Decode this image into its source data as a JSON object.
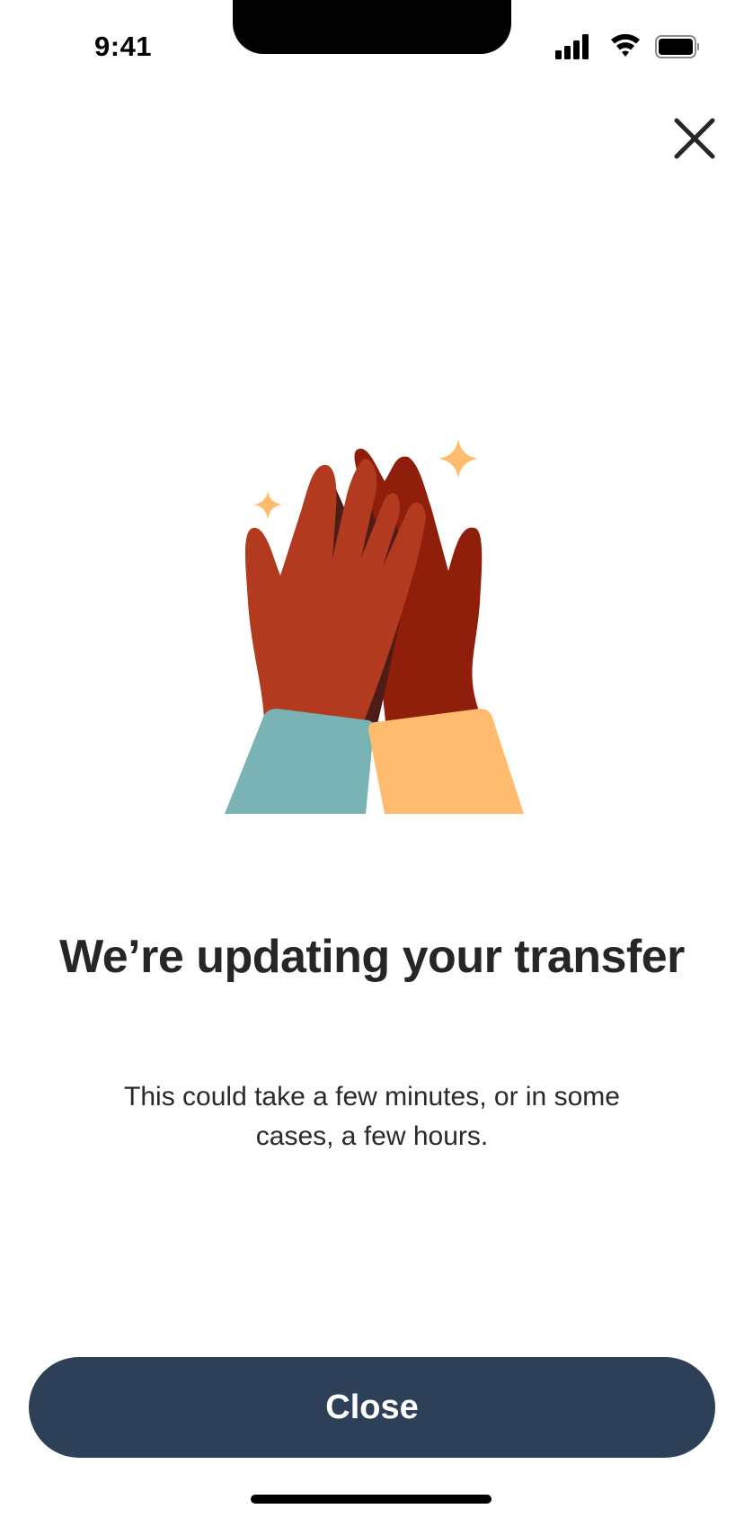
{
  "status_bar": {
    "time": "9:41",
    "icons": [
      "cellular-signal-icon",
      "wifi-icon",
      "battery-icon"
    ]
  },
  "header": {
    "close_icon": "close-icon"
  },
  "illustration": {
    "name": "high-five-hands",
    "colors": {
      "left_hand": "#b23a1f",
      "right_hand": "#8f1f0a",
      "shadow": "#4e1c17",
      "left_sleeve": "#79b3b6",
      "right_sleeve": "#ffbc6e",
      "sparkle": "#ffbc6e"
    }
  },
  "content": {
    "title": "We’re updating your transfer",
    "subtitle": "This could take a few minutes, or in some cases, a few hours."
  },
  "footer": {
    "close_label": "Close"
  },
  "colors": {
    "primary_button": "#2e4058",
    "text": "#262626",
    "background": "#ffffff"
  }
}
